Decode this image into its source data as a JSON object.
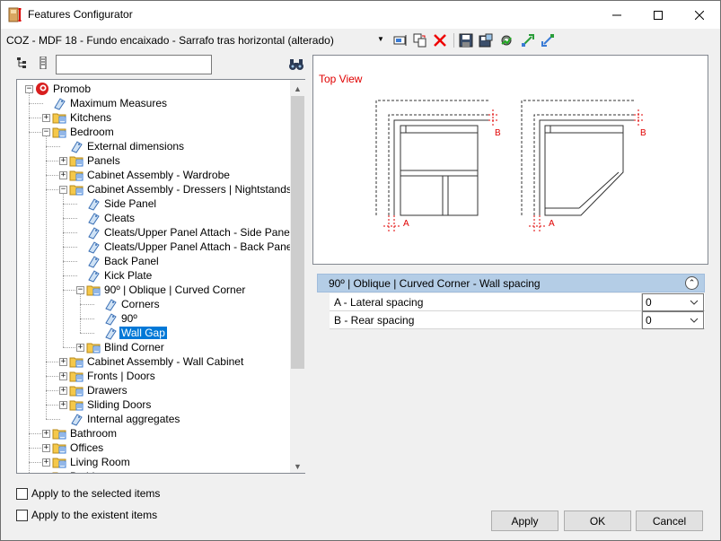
{
  "window": {
    "title": "Features Configurator"
  },
  "toolbar": {
    "configuration": "COZ - MDF 18 - Fundo encaixado - Sarrafo tras horizontal (alterado)"
  },
  "tree": {
    "search_value": "",
    "items": [
      {
        "label": "Promob"
      },
      {
        "label": "Maximum Measures"
      },
      {
        "label": "Kitchens"
      },
      {
        "label": "Bedroom"
      },
      {
        "label": "External dimensions"
      },
      {
        "label": "Panels"
      },
      {
        "label": "Cabinet Assembly - Wardrobe"
      },
      {
        "label": "Cabinet Assembly - Dressers | Nightstands"
      },
      {
        "label": "Side Panel"
      },
      {
        "label": "Cleats"
      },
      {
        "label": "Cleats/Upper Panel Attach - Side Panel"
      },
      {
        "label": "Cleats/Upper Panel Attach - Back Panel"
      },
      {
        "label": "Back Panel"
      },
      {
        "label": "Kick Plate"
      },
      {
        "label": "90º | Oblique | Curved Corner"
      },
      {
        "label": "Corners"
      },
      {
        "label": "90º"
      },
      {
        "label": "Wall Gap"
      },
      {
        "label": "Blind Corner"
      },
      {
        "label": "Cabinet Assembly - Wall Cabinet"
      },
      {
        "label": "Fronts | Doors"
      },
      {
        "label": "Drawers"
      },
      {
        "label": "Sliding Doors"
      },
      {
        "label": "Internal aggregates"
      },
      {
        "label": "Bathroom"
      },
      {
        "label": "Offices"
      },
      {
        "label": "Living Room"
      },
      {
        "label": "Bathhouse"
      }
    ]
  },
  "preview": {
    "title": "Top View",
    "label_a": "A",
    "label_b": "B",
    "accent_color": "#e00000"
  },
  "properties": {
    "header": "90º | Oblique | Curved Corner - Wall spacing",
    "rows": [
      {
        "name": "A - Lateral spacing",
        "value": "0"
      },
      {
        "name": "B - Rear spacing",
        "value": "0"
      }
    ]
  },
  "options": {
    "apply_selected": "Apply to the selected items",
    "apply_existent": "Apply to the existent items"
  },
  "buttons": {
    "apply": "Apply",
    "ok": "OK",
    "cancel": "Cancel"
  }
}
